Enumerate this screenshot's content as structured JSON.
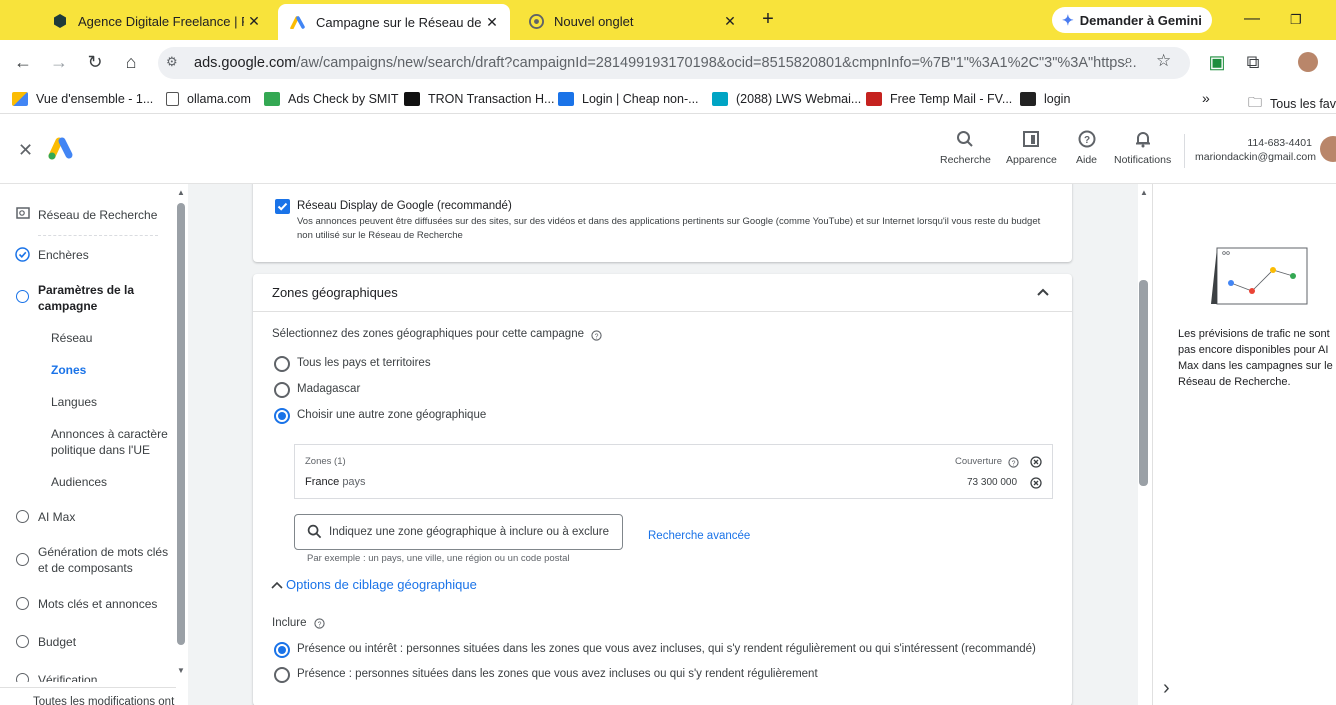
{
  "browser": {
    "tabs": [
      {
        "title": "Agence Digitale Freelance | Ray",
        "close": "✕"
      },
      {
        "title": "Campagne sur le Réseau de Rec",
        "close": "✕"
      },
      {
        "title": "Nouvel onglet",
        "close": "✕"
      }
    ],
    "new_tab": "+",
    "gemini_button": "Demander à Gemini",
    "url_host": "ads.google.com",
    "url_path": "/aw/campaigns/new/search/draft?campaignId=281499193170198&ocid=8515820801&cmpnInfo=%7B\"1\"%3A1%2C\"3\"%3A\"https...",
    "bookmarks": [
      "Vue d'ensemble - 1...",
      "ollama.com",
      "Ads Check by SMIT",
      "TRON Transaction H...",
      "Login | Cheap non-...",
      "(2088) LWS Webmai...",
      "Free Temp Mail - FV...",
      "login"
    ],
    "bookmarks_more": "»",
    "bookmarks_folder": "Tous les favo"
  },
  "header": {
    "close": "✕",
    "search_label": "Recherche",
    "appearance_label": "Apparence",
    "help_label": "Aide",
    "notifications_label": "Notifications",
    "account_id": "114-683-4401",
    "account_email": "mariondackin@gmail.com"
  },
  "sidebar": {
    "items": [
      {
        "label": "Réseau de Recherche"
      },
      {
        "label": "Enchères"
      },
      {
        "label": "Paramètres de la campagne"
      },
      {
        "label": "Réseau"
      },
      {
        "label": "Zones"
      },
      {
        "label": "Langues"
      },
      {
        "label": "Annonces à caractère politique dans l'UE"
      },
      {
        "label": "Audiences"
      },
      {
        "label": "AI Max"
      },
      {
        "label": "Génération de mots clés et de composants"
      },
      {
        "label": "Mots clés et annonces"
      },
      {
        "label": "Budget"
      },
      {
        "label": "Vérification"
      }
    ],
    "footer": "Toutes les modifications ont é"
  },
  "display_network": {
    "title": "Réseau Display de Google (recommandé)",
    "description": "Vos annonces peuvent être diffusées sur des sites, sur des vidéos et dans des applications pertinents sur Google (comme YouTube) et sur Internet lorsqu'il vous reste du budget non utilisé sur le Réseau de Recherche",
    "checked": true
  },
  "geo": {
    "title": "Zones géographiques",
    "prompt": "Sélectionnez des zones géographiques pour cette campagne",
    "options": [
      "Tous les pays et territoires",
      "Madagascar",
      "Choisir une autre zone géographique"
    ],
    "selected": 2,
    "zones_header": "Zones (1)",
    "coverage_header": "Couverture",
    "zone_name": "France",
    "zone_type": "pays",
    "zone_coverage": "73 300 000",
    "search_placeholder": "Indiquez une zone géographique à inclure ou à exclure",
    "advanced_search": "Recherche avancée",
    "example": "Par exemple : un pays, une ville, une région ou un code postal",
    "targeting_options": "Options de ciblage géographique",
    "include_label": "Inclure",
    "include_options": [
      "Présence ou intérêt : personnes situées dans les zones que vous avez incluses, qui s'y rendent régulièrement ou qui s'intéressent (recommandé)",
      "Présence : personnes situées dans les zones que vous avez incluses ou qui s'y rendent régulièrement"
    ],
    "include_selected": 0
  },
  "right_panel": {
    "text": "Les prévisions de trafic ne sont pas encore disponibles pour AI Max dans les campagnes sur le Réseau de Recherche.",
    "chevron": "›"
  },
  "colors": {
    "tabbar": "#f8e33b",
    "accent": "#1a73e8",
    "page_bg": "#f1f3f4"
  }
}
